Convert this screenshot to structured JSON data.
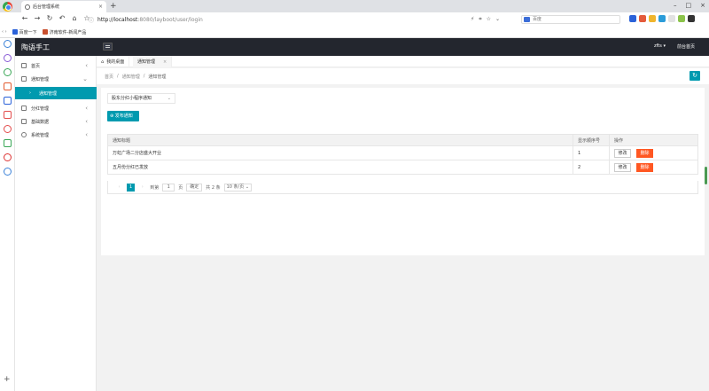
{
  "browser": {
    "tab_title": "后台管理系统",
    "url_host": "http://localhost",
    "url_path": ":8080/layboot/user/login",
    "search_placeholder": "百度",
    "bookmarks": [
      "百度一下",
      "济南软件-新闻产品"
    ]
  },
  "app": {
    "logo": "陶语手工",
    "user": "zfts",
    "user_caret": "▾",
    "front_link": "前台首页"
  },
  "sidebar": {
    "items": [
      {
        "label": "首页",
        "icon": "home-icon"
      },
      {
        "label": "通知管理",
        "icon": "bell-icon"
      },
      {
        "label": "通知管理",
        "icon": "none"
      },
      {
        "label": "分红管理",
        "icon": "grid-icon"
      },
      {
        "label": "基础数据",
        "icon": "database-icon"
      },
      {
        "label": "系统管理",
        "icon": "gear-icon"
      }
    ]
  },
  "tabs": [
    {
      "label": "我的桌面"
    },
    {
      "label": "通知管理"
    }
  ],
  "breadcrumb": [
    "首页",
    "通知管理",
    "通知管理"
  ],
  "filter": {
    "selected": "股东分红小程序通知"
  },
  "publish_button": "发布通知",
  "table": {
    "headers": [
      "通知标题",
      "显示顺序号",
      "操作"
    ],
    "rows": [
      {
        "title": "万虹广场二分店盛大开业",
        "order": "1"
      },
      {
        "title": "五月份分红已发放",
        "order": "2"
      }
    ],
    "edit_label": "修改",
    "delete_label": "删除"
  },
  "pagination": {
    "prev": "‹",
    "current": "1",
    "next": "›",
    "goto_label": "到第",
    "page_input": "1",
    "page_unit": "页",
    "confirm": "确定",
    "total": "共 2 条",
    "page_size": "10 条/页"
  }
}
